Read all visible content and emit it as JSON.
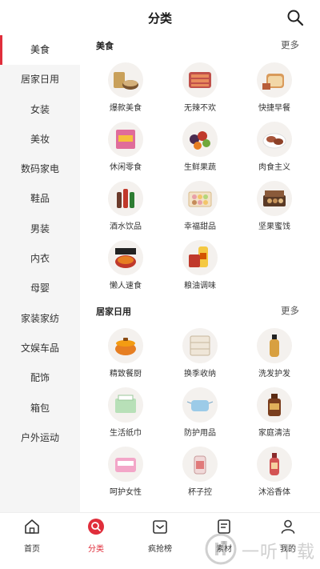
{
  "header": {
    "title": "分类"
  },
  "sidebar": {
    "items": [
      {
        "label": "美食",
        "active": true
      },
      {
        "label": "居家日用"
      },
      {
        "label": "女装"
      },
      {
        "label": "美妆"
      },
      {
        "label": "数码家电"
      },
      {
        "label": "鞋品"
      },
      {
        "label": "男装"
      },
      {
        "label": "内衣"
      },
      {
        "label": "母婴"
      },
      {
        "label": "家装家纺"
      },
      {
        "label": "文娱车品"
      },
      {
        "label": "配饰"
      },
      {
        "label": "箱包"
      },
      {
        "label": "户外运动"
      }
    ]
  },
  "sections": [
    {
      "title": "美食",
      "more": "更多",
      "items": [
        {
          "label": "爆款美食",
          "icon": "snack-bowl-icon"
        },
        {
          "label": "无辣不欢",
          "icon": "spicy-meat-icon"
        },
        {
          "label": "快捷早餐",
          "icon": "bread-icon"
        },
        {
          "label": "休闲零食",
          "icon": "snack-bag-icon"
        },
        {
          "label": "生鲜果蔬",
          "icon": "fruit-plate-icon"
        },
        {
          "label": "肉食主义",
          "icon": "meat-plate-icon"
        },
        {
          "label": "酒水饮品",
          "icon": "drink-bottles-icon"
        },
        {
          "label": "幸福甜品",
          "icon": "dessert-box-icon"
        },
        {
          "label": "坚果蜜饯",
          "icon": "nut-gift-box-icon"
        },
        {
          "label": "懒人速食",
          "icon": "hotpot-icon"
        },
        {
          "label": "粮油调味",
          "icon": "oil-rice-icon"
        }
      ]
    },
    {
      "title": "居家日用",
      "more": "更多",
      "items": [
        {
          "label": "精致餐厨",
          "icon": "pot-icon"
        },
        {
          "label": "换季收纳",
          "icon": "storage-box-icon"
        },
        {
          "label": "洗发护发",
          "icon": "shampoo-icon"
        },
        {
          "label": "生活纸巾",
          "icon": "tissue-icon"
        },
        {
          "label": "防护用品",
          "icon": "mask-icon"
        },
        {
          "label": "家庭清洁",
          "icon": "cleaner-bottle-icon"
        },
        {
          "label": "呵护女性",
          "icon": "pad-icon"
        },
        {
          "label": "杯子控",
          "icon": "cup-icon"
        },
        {
          "label": "沐浴香体",
          "icon": "body-wash-icon"
        }
      ]
    }
  ],
  "tabbar": {
    "items": [
      {
        "label": "首页",
        "icon": "home-icon"
      },
      {
        "label": "分类",
        "icon": "category-search-icon",
        "active": true
      },
      {
        "label": "疯抢榜",
        "icon": "ranking-icon"
      },
      {
        "label": "素材",
        "icon": "material-icon"
      },
      {
        "label": "我的",
        "icon": "profile-icon"
      }
    ]
  },
  "watermark": {
    "text": "一听下载"
  },
  "colors": {
    "accent": "#e02e3b",
    "sidebar_bg": "#f5f5f5"
  }
}
